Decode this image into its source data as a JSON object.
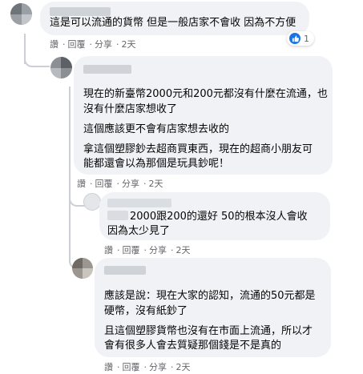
{
  "comments": [
    {
      "id": "c1",
      "lines": [
        "這是可以流通的貨幣 但是一般店家不會收 因為不方便"
      ],
      "reaction_count": "1",
      "actions": {
        "like": "讚",
        "reply": "回覆",
        "share": "分享",
        "time": "2天"
      }
    },
    {
      "id": "c2",
      "paragraphs": [
        [
          "現在的新臺幣2000元和200元都沒有什麼在流通，也",
          "沒有什麼店家想收了"
        ],
        [
          "這個應該更不會有店家想去收的"
        ],
        [
          "拿這個塑膠鈔去超商買東西，現在的超商小朋友可",
          "能都還會以為那個是玩具鈔呢！"
        ]
      ],
      "actions": {
        "like": "讚",
        "reply": "回覆",
        "share": "分享",
        "time": "2天"
      }
    },
    {
      "id": "c3",
      "lines": [
        "2000跟200的還好 50的根本沒人會收",
        "因為太少見了"
      ],
      "actions": {
        "like": "讚",
        "reply": "回覆",
        "share": "分享",
        "time": "2天"
      }
    },
    {
      "id": "c4",
      "paragraphs": [
        [
          "應該是說：現在大家的認知，流通的50元都是",
          "硬幣，沒有紙鈔了"
        ],
        [
          "且這個塑膠貨幣也沒有在市面上流通，所以才",
          "會有很多人會去質疑那個錢是不是真的"
        ]
      ],
      "actions": {
        "like": "讚",
        "reply": "回覆",
        "share": "分享",
        "time": "2天"
      }
    }
  ],
  "colors": {
    "bubble": "#f0f2f5",
    "meta": "#65676b",
    "like": "#1b74e4"
  }
}
